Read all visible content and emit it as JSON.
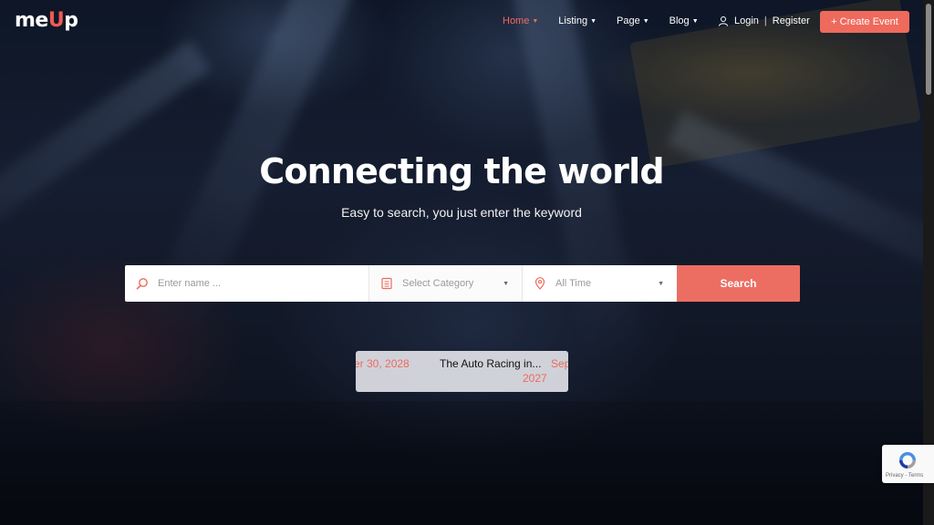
{
  "logo": {
    "prefix": "me",
    "accent": "U",
    "suffix": "p"
  },
  "nav": [
    {
      "label": "Home",
      "active": true
    },
    {
      "label": "Listing",
      "active": false
    },
    {
      "label": "Page",
      "active": false
    },
    {
      "label": "Blog",
      "active": false
    }
  ],
  "auth": {
    "login": "Login",
    "separator": "|",
    "register": "Register"
  },
  "create_event": "+ Create Event",
  "hero": {
    "title": "Connecting the world",
    "subtitle": "Easy to search, you just enter the keyword"
  },
  "search": {
    "name_placeholder": "Enter name ...",
    "category": "Select Category",
    "time": "All Time",
    "button": "Search"
  },
  "ticker": {
    "date_prev": "er 30, 2028",
    "title": "The Auto Racing in...",
    "date_next": "Sep",
    "year_next": "2027"
  },
  "recaptcha": {
    "terms": "Privacy - Terms"
  },
  "colors": {
    "accent": "#ee6a5d",
    "nav_active": "#ef6a5f"
  }
}
